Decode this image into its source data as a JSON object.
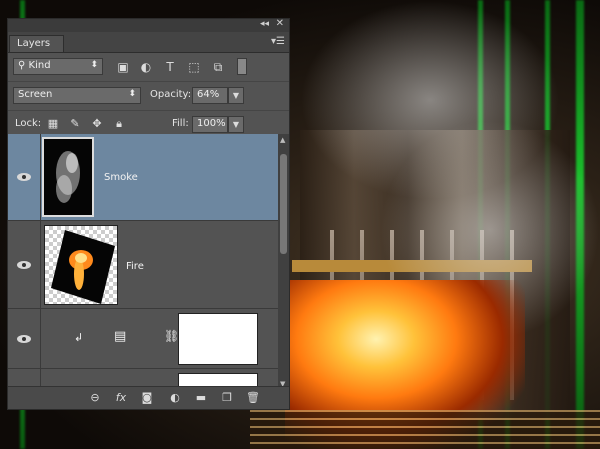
{
  "panel": {
    "title": "Layers",
    "collapse_icon": "double-chevron",
    "close_icon": "x",
    "menu_icon": "hamburger"
  },
  "filter": {
    "kind_label": "Kind",
    "icons": [
      "image-filter-icon",
      "adjustment-filter-icon",
      "type-filter-icon",
      "shape-filter-icon",
      "smart-object-filter-icon"
    ]
  },
  "blend": {
    "mode": "Screen",
    "opacity_label": "Opacity:",
    "opacity_value": "64%"
  },
  "lock": {
    "label": "Lock:",
    "fill_label": "Fill:",
    "fill_value": "100%"
  },
  "layers": [
    {
      "name": "Smoke",
      "selected": true
    },
    {
      "name": "Fire",
      "selected": false
    },
    {
      "name": "",
      "selected": false
    }
  ],
  "colors": {
    "panel_bg": "#535353",
    "selection": "#6d87a0"
  }
}
